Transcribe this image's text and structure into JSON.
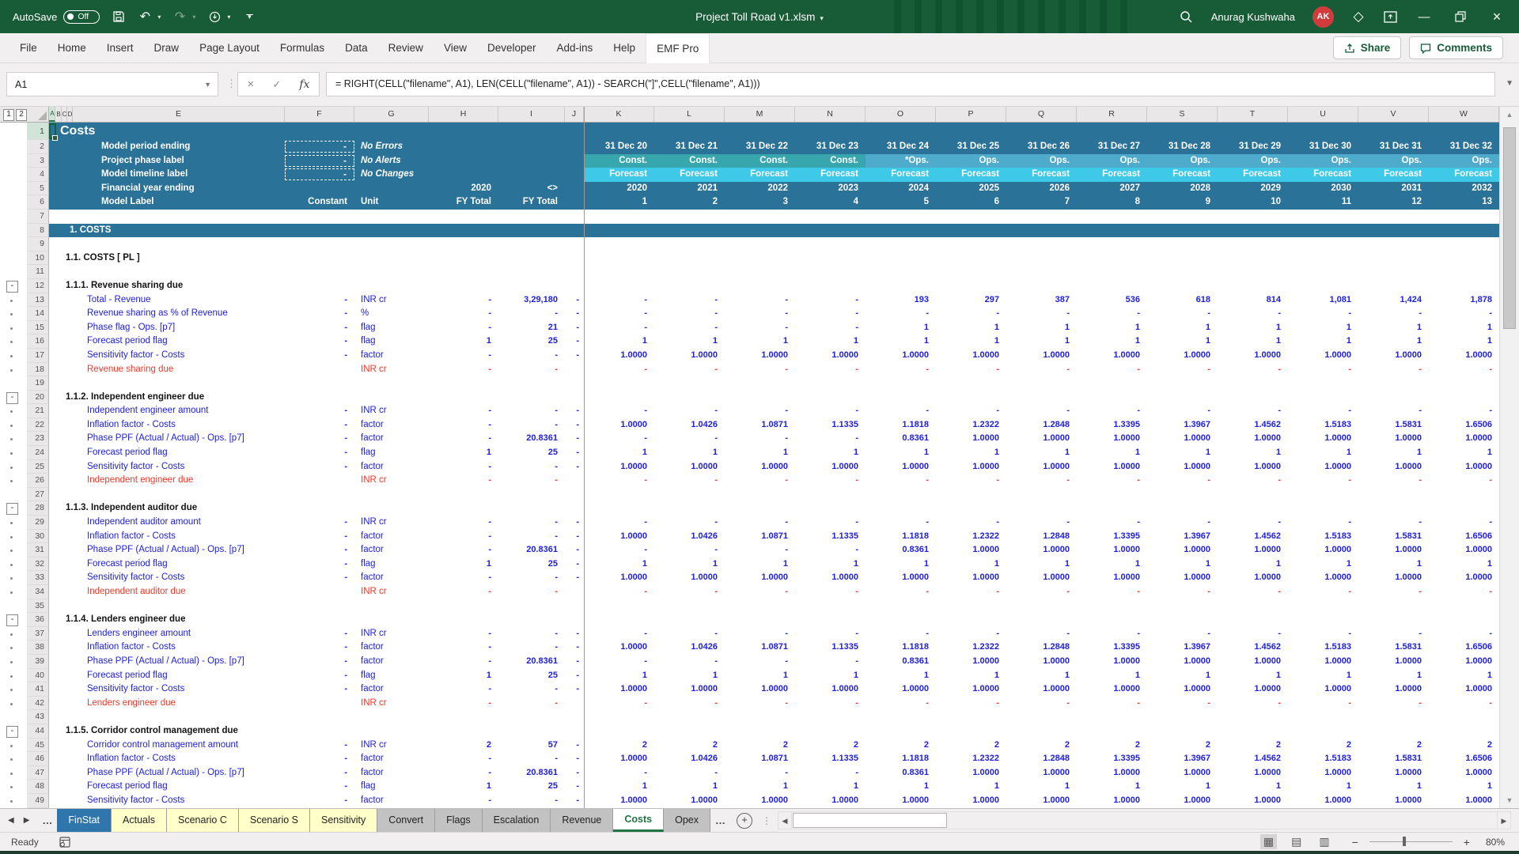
{
  "colors": {
    "titlebar_green": "#185C37",
    "excel_green": "#217346",
    "header_blue": "#2B7299",
    "const": "#38A6AD",
    "ops": "#4FABCB",
    "forecast": "#3EC9E9",
    "data_blue": "#2020DD",
    "result_red": "#EF3829",
    "finstat_tab": "#2E76AB",
    "yellow_tab": "#FFFFC9",
    "gray_tab": "#C2C2C2",
    "avatar_red": "#D13B3B"
  },
  "titlebar": {
    "autosave_label": "AutoSave",
    "autosave_state": "Off",
    "title": "Project Toll Road v1.xlsm",
    "user_name": "Anurag Kushwaha",
    "avatar_initials": "AK"
  },
  "ribbon": {
    "tabs": [
      "File",
      "Home",
      "Insert",
      "Draw",
      "Page Layout",
      "Formulas",
      "Data",
      "Review",
      "View",
      "Developer",
      "Add-ins",
      "Help",
      "EMF Pro"
    ],
    "active_tab": "EMF Pro",
    "share_label": "Share",
    "comments_label": "Comments"
  },
  "formula_bar": {
    "name_box": "A1",
    "fx_label": "fx",
    "formula": "= RIGHT(CELL(\"filename\", A1), LEN(CELL(\"filename\", A1)) - SEARCH(\"]\",CELL(\"filename\", A1)))"
  },
  "grid": {
    "outline_levels": [
      "1",
      "2"
    ],
    "columns": [
      "A",
      "B",
      "C",
      "D",
      "E",
      "F",
      "G",
      "H",
      "I",
      "J",
      "K",
      "L",
      "M",
      "N",
      "O",
      "P",
      "Q",
      "R",
      "S",
      "T",
      "U",
      "V",
      "W"
    ],
    "header": {
      "title": "Costs",
      "rows": [
        {
          "n": 2,
          "label": "Model period ending",
          "f": "-",
          "f_dashed": true,
          "g": "No Errors",
          "g_italic": true,
          "h": "",
          "i": "",
          "j": "",
          "y": [
            "31 Dec 20",
            "31 Dec 21",
            "31 Dec 22",
            "31 Dec 23",
            "31 Dec 24",
            "31 Dec 25",
            "31 Dec 26",
            "31 Dec 27",
            "31 Dec 28",
            "31 Dec 29",
            "31 Dec 30",
            "31 Dec 31",
            "31 Dec 32"
          ]
        },
        {
          "n": 3,
          "label": "Project phase label",
          "f": "-",
          "f_dashed": true,
          "g": "No Alerts",
          "g_italic": true,
          "h": "",
          "i": "",
          "j": "",
          "y": [
            "Const.",
            "Const.",
            "Const.",
            "Const.",
            "*Ops.",
            "Ops.",
            "Ops.",
            "Ops.",
            "Ops.",
            "Ops.",
            "Ops.",
            "Ops.",
            "Ops."
          ],
          "bg": [
            "const",
            "const",
            "const",
            "const",
            "ops",
            "ops",
            "ops",
            "ops",
            "ops",
            "ops",
            "ops",
            "ops",
            "ops"
          ]
        },
        {
          "n": 4,
          "label": "Model timeline label",
          "f": "-",
          "f_dashed": true,
          "g": "No Changes",
          "g_italic": true,
          "h": "",
          "i": "",
          "j": "",
          "y": [
            "Forecast",
            "Forecast",
            "Forecast",
            "Forecast",
            "Forecast",
            "Forecast",
            "Forecast",
            "Forecast",
            "Forecast",
            "Forecast",
            "Forecast",
            "Forecast",
            "Forecast"
          ],
          "bg": [
            "forecast",
            "forecast",
            "forecast",
            "forecast",
            "forecast",
            "forecast",
            "forecast",
            "forecast",
            "forecast",
            "forecast",
            "forecast",
            "forecast",
            "forecast"
          ]
        },
        {
          "n": 5,
          "label": "Financial year ending",
          "f": "",
          "g": "",
          "h": "2020",
          "i": "<>",
          "j": "",
          "y": [
            "2020",
            "2021",
            "2022",
            "2023",
            "2024",
            "2025",
            "2026",
            "2027",
            "2028",
            "2029",
            "2030",
            "2031",
            "2032"
          ]
        },
        {
          "n": 6,
          "label": "Model Label",
          "f": "Constant",
          "g": "Unit",
          "h": "FY Total",
          "i": "FY Total",
          "j": "",
          "y": [
            "1",
            "2",
            "3",
            "4",
            "5",
            "6",
            "7",
            "8",
            "9",
            "10",
            "11",
            "12",
            "13"
          ]
        }
      ]
    },
    "rows": [
      {
        "n": 7,
        "t": "blank"
      },
      {
        "n": 8,
        "t": "bar",
        "label": "1. COSTS"
      },
      {
        "n": 9,
        "t": "blank"
      },
      {
        "n": 10,
        "t": "sub",
        "label": "1.1. COSTS [ PL ]"
      },
      {
        "n": 11,
        "t": "blank"
      },
      {
        "n": 12,
        "t": "section",
        "label": "1.1.1. Revenue sharing due"
      },
      {
        "n": 13,
        "t": "data",
        "e": "Total - Revenue",
        "f": "-",
        "g": "INR cr",
        "h": "-",
        "i": "3,29,180",
        "j": "-",
        "y": [
          "-",
          "-",
          "-",
          "-",
          "193",
          "297",
          "387",
          "536",
          "618",
          "814",
          "1,081",
          "1,424",
          "1,878"
        ]
      },
      {
        "n": 14,
        "t": "data",
        "e": "Revenue sharing as % of Revenue",
        "f": "-",
        "g": "%",
        "h": "-",
        "i": "-",
        "j": "-",
        "y": [
          "-",
          "-",
          "-",
          "-",
          "-",
          "-",
          "-",
          "-",
          "-",
          "-",
          "-",
          "-",
          "-"
        ]
      },
      {
        "n": 15,
        "t": "data",
        "e": "Phase flag - Ops. [p7]",
        "f": "-",
        "g": "flag",
        "h": "-",
        "i": "21",
        "j": "-",
        "y": [
          "-",
          "-",
          "-",
          "-",
          "1",
          "1",
          "1",
          "1",
          "1",
          "1",
          "1",
          "1",
          "1"
        ]
      },
      {
        "n": 16,
        "t": "data",
        "e": "Forecast period flag",
        "f": "-",
        "g": "flag",
        "h": "1",
        "i": "25",
        "j": "-",
        "y": [
          "1",
          "1",
          "1",
          "1",
          "1",
          "1",
          "1",
          "1",
          "1",
          "1",
          "1",
          "1",
          "1"
        ]
      },
      {
        "n": 17,
        "t": "data",
        "e": "Sensitivity factor - Costs",
        "f": "-",
        "g": "factor",
        "h": "-",
        "i": "-",
        "j": "-",
        "y": [
          "1.0000",
          "1.0000",
          "1.0000",
          "1.0000",
          "1.0000",
          "1.0000",
          "1.0000",
          "1.0000",
          "1.0000",
          "1.0000",
          "1.0000",
          "1.0000",
          "1.0000"
        ]
      },
      {
        "n": 18,
        "t": "result",
        "e": "Revenue sharing due",
        "f": "",
        "g": "INR cr",
        "h": "-",
        "i": "-",
        "j": "",
        "y": [
          "-",
          "-",
          "-",
          "-",
          "-",
          "-",
          "-",
          "-",
          "-",
          "-",
          "-",
          "-",
          "-"
        ]
      },
      {
        "n": 19,
        "t": "blank"
      },
      {
        "n": 20,
        "t": "section",
        "label": "1.1.2. Independent engineer due"
      },
      {
        "n": 21,
        "t": "data",
        "e": "Independent engineer amount",
        "f": "-",
        "g": "INR cr",
        "h": "-",
        "i": "-",
        "j": "-",
        "y": [
          "-",
          "-",
          "-",
          "-",
          "-",
          "-",
          "-",
          "-",
          "-",
          "-",
          "-",
          "-",
          "-"
        ]
      },
      {
        "n": 22,
        "t": "data",
        "e": "Inflation factor - Costs",
        "f": "-",
        "g": "factor",
        "h": "-",
        "i": "-",
        "j": "-",
        "y": [
          "1.0000",
          "1.0426",
          "1.0871",
          "1.1335",
          "1.1818",
          "1.2322",
          "1.2848",
          "1.3395",
          "1.3967",
          "1.4562",
          "1.5183",
          "1.5831",
          "1.6506"
        ]
      },
      {
        "n": 23,
        "t": "data",
        "e": "Phase PPF (Actual / Actual) - Ops. [p7]",
        "f": "-",
        "g": "factor",
        "h": "-",
        "i": "20.8361",
        "j": "-",
        "y": [
          "-",
          "-",
          "-",
          "-",
          "0.8361",
          "1.0000",
          "1.0000",
          "1.0000",
          "1.0000",
          "1.0000",
          "1.0000",
          "1.0000",
          "1.0000"
        ]
      },
      {
        "n": 24,
        "t": "data",
        "e": "Forecast period flag",
        "f": "-",
        "g": "flag",
        "h": "1",
        "i": "25",
        "j": "-",
        "y": [
          "1",
          "1",
          "1",
          "1",
          "1",
          "1",
          "1",
          "1",
          "1",
          "1",
          "1",
          "1",
          "1"
        ]
      },
      {
        "n": 25,
        "t": "data",
        "e": "Sensitivity factor - Costs",
        "f": "-",
        "g": "factor",
        "h": "-",
        "i": "-",
        "j": "-",
        "y": [
          "1.0000",
          "1.0000",
          "1.0000",
          "1.0000",
          "1.0000",
          "1.0000",
          "1.0000",
          "1.0000",
          "1.0000",
          "1.0000",
          "1.0000",
          "1.0000",
          "1.0000"
        ]
      },
      {
        "n": 26,
        "t": "result",
        "e": "Independent engineer due",
        "f": "",
        "g": "INR cr",
        "h": "-",
        "i": "-",
        "j": "",
        "y": [
          "-",
          "-",
          "-",
          "-",
          "-",
          "-",
          "-",
          "-",
          "-",
          "-",
          "-",
          "-",
          "-"
        ]
      },
      {
        "n": 27,
        "t": "blank"
      },
      {
        "n": 28,
        "t": "section",
        "label": "1.1.3. Independent auditor due"
      },
      {
        "n": 29,
        "t": "data",
        "e": "Independent auditor amount",
        "f": "-",
        "g": "INR cr",
        "h": "-",
        "i": "-",
        "j": "-",
        "y": [
          "-",
          "-",
          "-",
          "-",
          "-",
          "-",
          "-",
          "-",
          "-",
          "-",
          "-",
          "-",
          "-"
        ]
      },
      {
        "n": 30,
        "t": "data",
        "e": "Inflation factor - Costs",
        "f": "-",
        "g": "factor",
        "h": "-",
        "i": "-",
        "j": "-",
        "y": [
          "1.0000",
          "1.0426",
          "1.0871",
          "1.1335",
          "1.1818",
          "1.2322",
          "1.2848",
          "1.3395",
          "1.3967",
          "1.4562",
          "1.5183",
          "1.5831",
          "1.6506"
        ]
      },
      {
        "n": 31,
        "t": "data",
        "e": "Phase PPF (Actual / Actual) - Ops. [p7]",
        "f": "-",
        "g": "factor",
        "h": "-",
        "i": "20.8361",
        "j": "-",
        "y": [
          "-",
          "-",
          "-",
          "-",
          "0.8361",
          "1.0000",
          "1.0000",
          "1.0000",
          "1.0000",
          "1.0000",
          "1.0000",
          "1.0000",
          "1.0000"
        ]
      },
      {
        "n": 32,
        "t": "data",
        "e": "Forecast period flag",
        "f": "-",
        "g": "flag",
        "h": "1",
        "i": "25",
        "j": "-",
        "y": [
          "1",
          "1",
          "1",
          "1",
          "1",
          "1",
          "1",
          "1",
          "1",
          "1",
          "1",
          "1",
          "1"
        ]
      },
      {
        "n": 33,
        "t": "data",
        "e": "Sensitivity factor - Costs",
        "f": "-",
        "g": "factor",
        "h": "-",
        "i": "-",
        "j": "-",
        "y": [
          "1.0000",
          "1.0000",
          "1.0000",
          "1.0000",
          "1.0000",
          "1.0000",
          "1.0000",
          "1.0000",
          "1.0000",
          "1.0000",
          "1.0000",
          "1.0000",
          "1.0000"
        ]
      },
      {
        "n": 34,
        "t": "result",
        "e": "Independent auditor due",
        "f": "",
        "g": "INR cr",
        "h": "-",
        "i": "-",
        "j": "",
        "y": [
          "-",
          "-",
          "-",
          "-",
          "-",
          "-",
          "-",
          "-",
          "-",
          "-",
          "-",
          "-",
          "-"
        ]
      },
      {
        "n": 35,
        "t": "blank"
      },
      {
        "n": 36,
        "t": "section",
        "label": "1.1.4. Lenders engineer due"
      },
      {
        "n": 37,
        "t": "data",
        "e": "Lenders engineer amount",
        "f": "-",
        "g": "INR cr",
        "h": "-",
        "i": "-",
        "j": "-",
        "y": [
          "-",
          "-",
          "-",
          "-",
          "-",
          "-",
          "-",
          "-",
          "-",
          "-",
          "-",
          "-",
          "-"
        ]
      },
      {
        "n": 38,
        "t": "data",
        "e": "Inflation factor - Costs",
        "f": "-",
        "g": "factor",
        "h": "-",
        "i": "-",
        "j": "-",
        "y": [
          "1.0000",
          "1.0426",
          "1.0871",
          "1.1335",
          "1.1818",
          "1.2322",
          "1.2848",
          "1.3395",
          "1.3967",
          "1.4562",
          "1.5183",
          "1.5831",
          "1.6506"
        ]
      },
      {
        "n": 39,
        "t": "data",
        "e": "Phase PPF (Actual / Actual) - Ops. [p7]",
        "f": "-",
        "g": "factor",
        "h": "-",
        "i": "20.8361",
        "j": "-",
        "y": [
          "-",
          "-",
          "-",
          "-",
          "0.8361",
          "1.0000",
          "1.0000",
          "1.0000",
          "1.0000",
          "1.0000",
          "1.0000",
          "1.0000",
          "1.0000"
        ]
      },
      {
        "n": 40,
        "t": "data",
        "e": "Forecast period flag",
        "f": "-",
        "g": "flag",
        "h": "1",
        "i": "25",
        "j": "-",
        "y": [
          "1",
          "1",
          "1",
          "1",
          "1",
          "1",
          "1",
          "1",
          "1",
          "1",
          "1",
          "1",
          "1"
        ]
      },
      {
        "n": 41,
        "t": "data",
        "e": "Sensitivity factor - Costs",
        "f": "-",
        "g": "factor",
        "h": "-",
        "i": "-",
        "j": "-",
        "y": [
          "1.0000",
          "1.0000",
          "1.0000",
          "1.0000",
          "1.0000",
          "1.0000",
          "1.0000",
          "1.0000",
          "1.0000",
          "1.0000",
          "1.0000",
          "1.0000",
          "1.0000"
        ]
      },
      {
        "n": 42,
        "t": "result",
        "e": "Lenders engineer due",
        "f": "",
        "g": "INR cr",
        "h": "-",
        "i": "-",
        "j": "",
        "y": [
          "-",
          "-",
          "-",
          "-",
          "-",
          "-",
          "-",
          "-",
          "-",
          "-",
          "-",
          "-",
          "-"
        ]
      },
      {
        "n": 43,
        "t": "blank"
      },
      {
        "n": 44,
        "t": "section",
        "label": "1.1.5. Corridor control management due"
      },
      {
        "n": 45,
        "t": "data",
        "e": "Corridor control management amount",
        "f": "-",
        "g": "INR cr",
        "h": "2",
        "i": "57",
        "j": "-",
        "y": [
          "2",
          "2",
          "2",
          "2",
          "2",
          "2",
          "2",
          "2",
          "2",
          "2",
          "2",
          "2",
          "2"
        ]
      },
      {
        "n": 46,
        "t": "data",
        "e": "Inflation factor - Costs",
        "f": "-",
        "g": "factor",
        "h": "-",
        "i": "-",
        "j": "-",
        "y": [
          "1.0000",
          "1.0426",
          "1.0871",
          "1.1335",
          "1.1818",
          "1.2322",
          "1.2848",
          "1.3395",
          "1.3967",
          "1.4562",
          "1.5183",
          "1.5831",
          "1.6506"
        ]
      },
      {
        "n": 47,
        "t": "data",
        "e": "Phase PPF (Actual / Actual) - Ops. [p7]",
        "f": "-",
        "g": "factor",
        "h": "-",
        "i": "20.8361",
        "j": "-",
        "y": [
          "-",
          "-",
          "-",
          "-",
          "0.8361",
          "1.0000",
          "1.0000",
          "1.0000",
          "1.0000",
          "1.0000",
          "1.0000",
          "1.0000",
          "1.0000"
        ]
      },
      {
        "n": 48,
        "t": "data",
        "e": "Forecast period flag",
        "f": "-",
        "g": "flag",
        "h": "1",
        "i": "25",
        "j": "-",
        "y": [
          "1",
          "1",
          "1",
          "1",
          "1",
          "1",
          "1",
          "1",
          "1",
          "1",
          "1",
          "1",
          "1"
        ]
      },
      {
        "n": 49,
        "t": "data",
        "e": "Sensitivity factor - Costs",
        "f": "-",
        "g": "factor",
        "h": "-",
        "i": "-",
        "j": "-",
        "y": [
          "1.0000",
          "1.0000",
          "1.0000",
          "1.0000",
          "1.0000",
          "1.0000",
          "1.0000",
          "1.0000",
          "1.0000",
          "1.0000",
          "1.0000",
          "1.0000",
          "1.0000"
        ]
      }
    ]
  },
  "sheet_bar": {
    "overflow_left": "…",
    "overflow_right": "…",
    "add_label": "+",
    "tabs": [
      {
        "label": "FinStat",
        "style": "blue"
      },
      {
        "label": "Actuals",
        "style": "yellow"
      },
      {
        "label": "Scenario C",
        "style": "yellow"
      },
      {
        "label": "Scenario S",
        "style": "yellow"
      },
      {
        "label": "Sensitivity",
        "style": "yellow"
      },
      {
        "label": "Convert",
        "style": "gray"
      },
      {
        "label": "Flags",
        "style": "gray"
      },
      {
        "label": "Escalation",
        "style": "gray"
      },
      {
        "label": "Revenue",
        "style": "gray"
      },
      {
        "label": "Costs",
        "style": "active"
      },
      {
        "label": "Opex",
        "style": "gray"
      }
    ],
    "active": "Costs"
  },
  "status_bar": {
    "mode": "Ready",
    "zoom_level": "80%"
  }
}
